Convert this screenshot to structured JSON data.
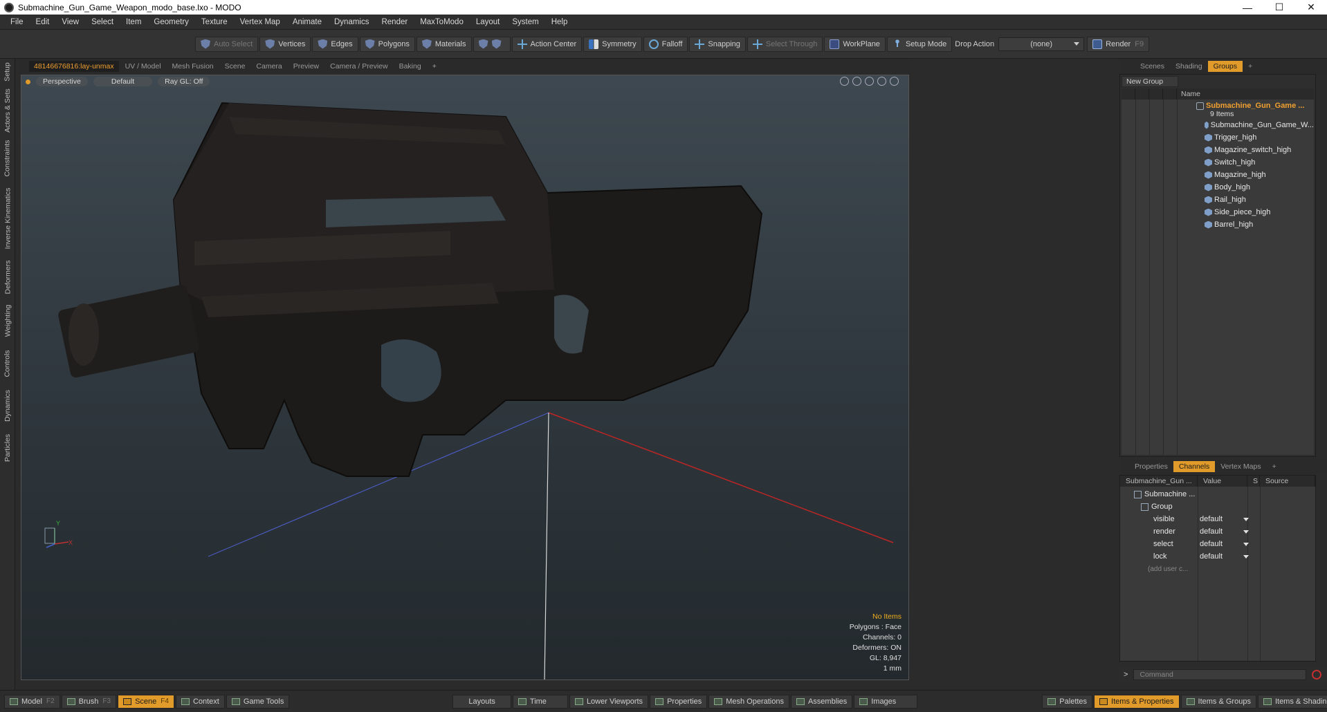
{
  "window": {
    "title": "Submachine_Gun_Game_Weapon_modo_base.lxo - MODO",
    "min": "—",
    "max": "☐",
    "close": "✕"
  },
  "menu": [
    "File",
    "Edit",
    "View",
    "Select",
    "Item",
    "Geometry",
    "Texture",
    "Vertex Map",
    "Animate",
    "Dynamics",
    "Render",
    "MaxToModo",
    "Layout",
    "System",
    "Help"
  ],
  "toolbar": {
    "auto_select": "Auto Select",
    "vertices": "Vertices",
    "edges": "Edges",
    "polygons": "Polygons",
    "materials": "Materials",
    "action_center": "Action Center",
    "symmetry": "Symmetry",
    "falloff": "Falloff",
    "snapping": "Snapping",
    "select_through": "Select Through",
    "workplane": "WorkPlane",
    "setup_mode": "Setup Mode",
    "drop_action": "Drop Action",
    "drop_value": "(none)",
    "render": "Render",
    "render_key": "F9"
  },
  "left_tabs": [
    "Setup",
    "Actors & Sets",
    "Constraints",
    "Inverse Kinematics",
    "Deformers",
    "Weighting",
    "Controls",
    "Dynamics",
    "Particles"
  ],
  "viewport_tabs": {
    "active": "48146676816:lay-unmax",
    "tabs": [
      "UV / Model",
      "Mesh Fusion",
      "Scene",
      "Camera",
      "Preview",
      "Camera / Preview",
      "Baking"
    ],
    "plus": "+"
  },
  "viewport": {
    "view": "Perspective",
    "shading": "Default",
    "raygl": "Ray GL: Off",
    "axis_y": "Y",
    "axis_x": "X",
    "hud": {
      "items": "No Items",
      "polygons": "Polygons : Face",
      "channels": "Channels: 0",
      "deformers": "Deformers: ON",
      "gl": "GL: 8,947",
      "scale": "1 mm"
    }
  },
  "right_tabs": {
    "tabs": [
      "Scenes",
      "Shading",
      "Groups"
    ],
    "active": "Groups",
    "plus": "+"
  },
  "groups": {
    "new_group": "New Group",
    "header_name": "Name",
    "group_name": "Submachine_Gun_Game ...",
    "group_count": "9 Items",
    "items": [
      "Submachine_Gun_Game_W...",
      "Trigger_high",
      "Magazine_switch_high",
      "Switch_high",
      "Magazine_high",
      "Body_high",
      "Rail_high",
      "Side_piece_high",
      "Barrel_high"
    ]
  },
  "lower_tabs": {
    "tabs": [
      "Properties",
      "Channels",
      "Vertex Maps"
    ],
    "active": "Channels",
    "plus": "+"
  },
  "channels": {
    "head_name": "Submachine_Gun ...",
    "head_value": "Value",
    "head_s": "S",
    "head_source": "Source",
    "root": "Submachine ...",
    "group": "Group",
    "rows": [
      {
        "name": "visible",
        "value": "default"
      },
      {
        "name": "render",
        "value": "default"
      },
      {
        "name": "select",
        "value": "default"
      },
      {
        "name": "lock",
        "value": "default"
      }
    ],
    "add_user": "(add user c..."
  },
  "command": {
    "placeholder": "Command",
    "prompt": ">"
  },
  "bottom": {
    "left": [
      {
        "label": "Model",
        "key": "F2"
      },
      {
        "label": "Brush",
        "key": "F3"
      },
      {
        "label": "Scene",
        "key": "F4"
      },
      {
        "label": "Context",
        "key": ""
      },
      {
        "label": "Game Tools",
        "key": ""
      }
    ],
    "active": "Scene",
    "center": [
      "Layouts",
      "Time",
      "Lower Viewports",
      "Properties",
      "Mesh Operations",
      "Assemblies",
      "Images"
    ],
    "right": [
      "Palettes",
      "Items & Properties",
      "Items & Groups",
      "Items & Shading"
    ],
    "right_active": "Items & Properties"
  }
}
